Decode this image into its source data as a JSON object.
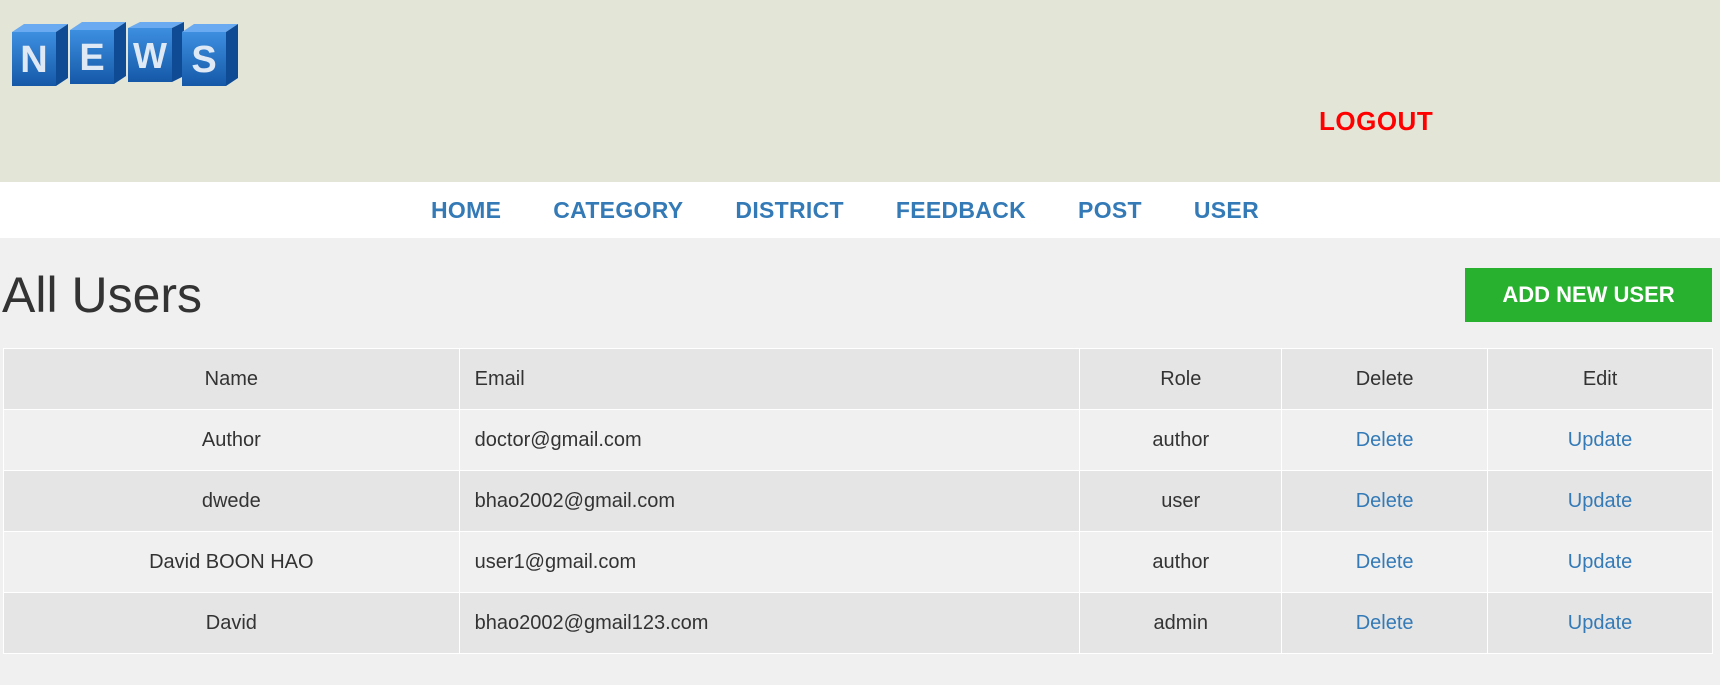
{
  "header": {
    "logo_letters": [
      "N",
      "E",
      "W",
      "S"
    ],
    "logo_color": "#1d6bbf",
    "logout_label": "LOGOUT"
  },
  "nav": {
    "items": [
      "HOME",
      "CATEGORY",
      "DISTRICT",
      "FEEDBACK",
      "POST",
      "USER"
    ]
  },
  "main": {
    "title": "All Users",
    "add_button_label": "ADD NEW USER",
    "table": {
      "headers": [
        "Name",
        "Email",
        "Role",
        "Delete",
        "Edit"
      ],
      "rows": [
        {
          "name": "Author",
          "email": "doctor@gmail.com",
          "role": "author",
          "delete": "Delete",
          "edit": "Update"
        },
        {
          "name": "dwede",
          "email": "bhao2002@gmail.com",
          "role": "user",
          "delete": "Delete",
          "edit": "Update"
        },
        {
          "name": "David BOON HAO",
          "email": "user1@gmail.com",
          "role": "author",
          "delete": "Delete",
          "edit": "Update"
        },
        {
          "name": "David",
          "email": "bhao2002@gmail123.com",
          "role": "admin",
          "delete": "Delete",
          "edit": "Update"
        }
      ]
    }
  },
  "colors": {
    "header_bg": "#e3e6d7",
    "link": "#337ab7",
    "logout": "#ff0000",
    "add_button": "#28b12f"
  }
}
